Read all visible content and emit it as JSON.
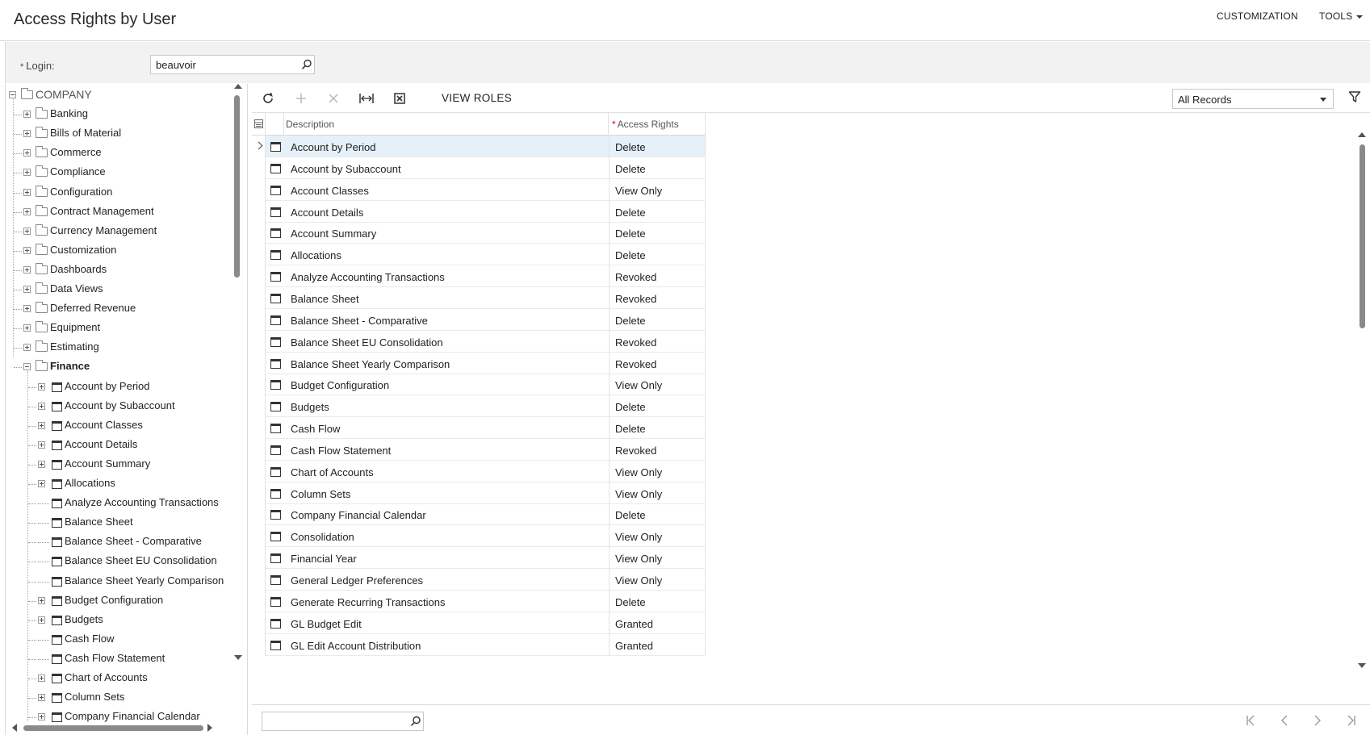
{
  "header": {
    "title": "Access Rights by User",
    "menu": [
      {
        "label": "CUSTOMIZATION"
      },
      {
        "label": "TOOLS"
      }
    ]
  },
  "form": {
    "login_label": "Login:",
    "login_value": "beauvoir"
  },
  "tree": {
    "root": "COMPANY",
    "folders": [
      "Banking",
      "Bills of Material",
      "Commerce",
      "Compliance",
      "Configuration",
      "Contract Management",
      "Currency Management",
      "Customization",
      "Dashboards",
      "Data Views",
      "Deferred Revenue",
      "Equipment",
      "Estimating",
      "Finance"
    ],
    "finance_items": [
      {
        "label": "Account by Period",
        "expandable": true
      },
      {
        "label": "Account by Subaccount",
        "expandable": true
      },
      {
        "label": "Account Classes",
        "expandable": true
      },
      {
        "label": "Account Details",
        "expandable": true
      },
      {
        "label": "Account Summary",
        "expandable": true
      },
      {
        "label": "Allocations",
        "expandable": true
      },
      {
        "label": "Analyze Accounting Transactions",
        "expandable": false
      },
      {
        "label": "Balance Sheet",
        "expandable": false
      },
      {
        "label": "Balance Sheet - Comparative",
        "expandable": false
      },
      {
        "label": "Balance Sheet EU Consolidation",
        "expandable": false
      },
      {
        "label": "Balance Sheet Yearly Comparison",
        "expandable": false
      },
      {
        "label": "Budget Configuration",
        "expandable": true
      },
      {
        "label": "Budgets",
        "expandable": true
      },
      {
        "label": "Cash Flow",
        "expandable": false
      },
      {
        "label": "Cash Flow Statement",
        "expandable": false
      },
      {
        "label": "Chart of Accounts",
        "expandable": true
      },
      {
        "label": "Column Sets",
        "expandable": true
      },
      {
        "label": "Company Financial Calendar",
        "expandable": true
      }
    ]
  },
  "toolbar": {
    "view_roles": "VIEW ROLES",
    "records_filter": "All Records"
  },
  "grid": {
    "columns": {
      "description": "Description",
      "access_rights": "Access Rights"
    },
    "rows": [
      {
        "description": "Account by Period",
        "rights": "Delete"
      },
      {
        "description": "Account by Subaccount",
        "rights": "Delete"
      },
      {
        "description": "Account Classes",
        "rights": "View Only"
      },
      {
        "description": "Account Details",
        "rights": "Delete"
      },
      {
        "description": "Account Summary",
        "rights": "Delete"
      },
      {
        "description": "Allocations",
        "rights": "Delete"
      },
      {
        "description": "Analyze Accounting Transactions",
        "rights": "Revoked"
      },
      {
        "description": "Balance Sheet",
        "rights": "Revoked"
      },
      {
        "description": "Balance Sheet - Comparative",
        "rights": "Delete"
      },
      {
        "description": "Balance Sheet EU Consolidation",
        "rights": "Revoked"
      },
      {
        "description": "Balance Sheet Yearly Comparison",
        "rights": "Revoked"
      },
      {
        "description": "Budget Configuration",
        "rights": "View Only"
      },
      {
        "description": "Budgets",
        "rights": "Delete"
      },
      {
        "description": "Cash Flow",
        "rights": "Delete"
      },
      {
        "description": "Cash Flow Statement",
        "rights": "Revoked"
      },
      {
        "description": "Chart of Accounts",
        "rights": "View Only"
      },
      {
        "description": "Column Sets",
        "rights": "View Only"
      },
      {
        "description": "Company Financial Calendar",
        "rights": "Delete"
      },
      {
        "description": "Consolidation",
        "rights": "View Only"
      },
      {
        "description": "Financial Year",
        "rights": "View Only"
      },
      {
        "description": "General Ledger Preferences",
        "rights": "View Only"
      },
      {
        "description": "Generate Recurring Transactions",
        "rights": "Delete"
      },
      {
        "description": "GL Budget Edit",
        "rights": "Granted"
      },
      {
        "description": "GL Edit Account Distribution",
        "rights": "Granted"
      }
    ]
  }
}
